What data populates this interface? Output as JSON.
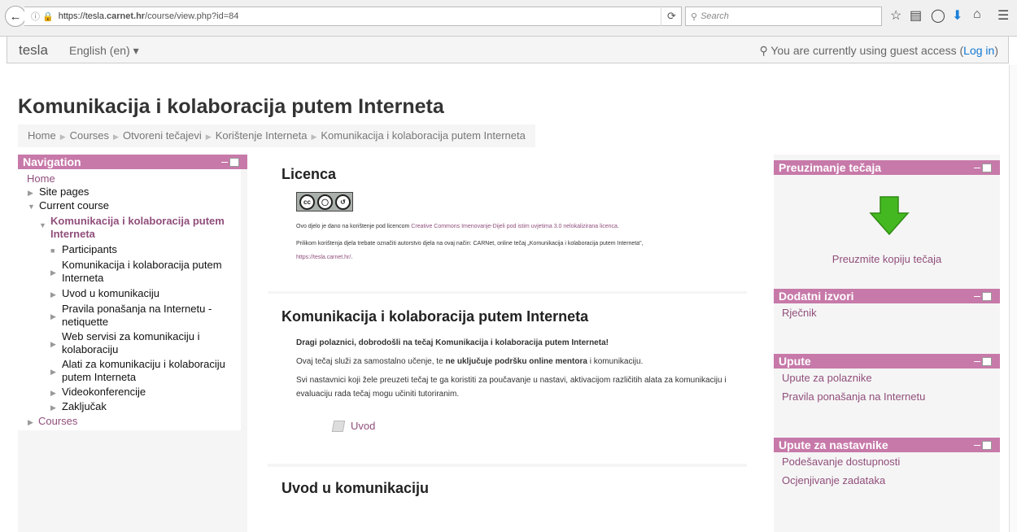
{
  "browser": {
    "url_prefix": "https://tesla.",
    "url_domain": "carnet.hr",
    "url_path": "/course/view.php?id=84",
    "search_placeholder": "Search"
  },
  "header": {
    "brand": "tesla",
    "language": "English (en) ▾",
    "guest_text": "You are currently using guest access (",
    "login": "Log in",
    "guest_close": ")"
  },
  "page": {
    "title": "Komunikacija i kolaboracija putem Interneta"
  },
  "breadcrumb": [
    "Home",
    "Courses",
    "Otvoreni tečajevi",
    "Korištenje Interneta",
    "Komunikacija i kolaboracija putem Interneta"
  ],
  "navigation": {
    "title": "Navigation",
    "home": "Home",
    "site_pages": "Site pages",
    "current_course": "Current course",
    "course_line1": "Komunikacija i kolaboracija putem",
    "course_line2": "Interneta",
    "participants": "Participants",
    "items": [
      {
        "l1": "Komunikacija i kolaboracija putem",
        "l2": "Interneta"
      },
      {
        "l1": "Uvod u komunikaciju",
        "l2": ""
      },
      {
        "l1": "Pravila ponašanja na Internetu -",
        "l2": "netiquette"
      },
      {
        "l1": "Web servisi za komunikaciju i",
        "l2": "kolaboraciju"
      },
      {
        "l1": "Alati za komunikaciju i kolaboraciju",
        "l2": "putem Interneta"
      },
      {
        "l1": "Videokonferencije",
        "l2": ""
      },
      {
        "l1": "Zaključak",
        "l2": ""
      }
    ],
    "courses": "Courses"
  },
  "main": {
    "licence_title": "Licenca",
    "cc_by": "BY",
    "cc_sa": "SA",
    "licence_text1": "Ovo djelo je dano na korištenje pod licencom ",
    "licence_link": "Creative Commons Imenovanje-Dijeli pod istim uvjetima 3.0 nelokalizirana licenca",
    "licence_text1_end": ".",
    "licence_text2": "Prilikom korištenja djela trebate označiti autorstvo djela na ovaj način: CARNet, online tečaj „Komunikacija i kolaboracija putem Interneta\",",
    "licence_url": "https://tesla.carnet.hr/",
    "licence_text2_end": ".",
    "course_title": "Komunikacija i kolaboracija putem Interneta",
    "welcome": "Dragi polaznici, dobrodošli na tečaj Komunikacija i kolaboracija putem Interneta!",
    "p1_a": "Ovaj tečaj služi za samostalno učenje, te ",
    "p1_b": "ne uključuje podršku online mentora",
    "p1_c": " i komunikaciju.",
    "p2": "Svi nastavnici koji žele preuzeti tečaj te ga koristiti za poučavanje u nastavi, aktivacijom različitih alata za komunikaciju i evaluaciju rada tečaj mogu učiniti tutoriranim.",
    "resource": "Uvod",
    "uvod_title": "Uvod u komunikaciju"
  },
  "right": {
    "download_title": "Preuzimanje tečaja",
    "download_link": "Preuzmite kopiju tečaja",
    "extra_title": "Dodatni izvori",
    "extra_items": [
      "Rječnik"
    ],
    "upute_title": "Upute",
    "upute_items": [
      "Upute za polaznike",
      "Pravila ponašanja na Internetu"
    ],
    "teacher_title": "Upute za nastavnike",
    "teacher_items": [
      "Podešavanje dostupnosti",
      "Ocjenjivanje zadataka"
    ]
  },
  "colors": {
    "accent": "#c779a9",
    "link": "#904e7b",
    "arrow": "#44b820"
  }
}
